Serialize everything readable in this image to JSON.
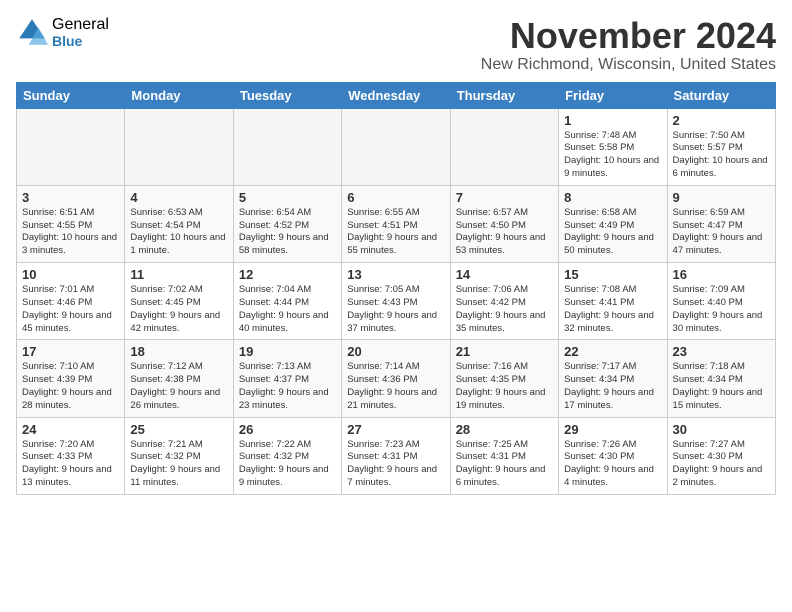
{
  "logo": {
    "general": "General",
    "blue": "Blue"
  },
  "title": "November 2024",
  "location": "New Richmond, Wisconsin, United States",
  "days_of_week": [
    "Sunday",
    "Monday",
    "Tuesday",
    "Wednesday",
    "Thursday",
    "Friday",
    "Saturday"
  ],
  "weeks": [
    [
      {
        "day": "",
        "info": ""
      },
      {
        "day": "",
        "info": ""
      },
      {
        "day": "",
        "info": ""
      },
      {
        "day": "",
        "info": ""
      },
      {
        "day": "",
        "info": ""
      },
      {
        "day": "1",
        "info": "Sunrise: 7:48 AM\nSunset: 5:58 PM\nDaylight: 10 hours and 9 minutes."
      },
      {
        "day": "2",
        "info": "Sunrise: 7:50 AM\nSunset: 5:57 PM\nDaylight: 10 hours and 6 minutes."
      }
    ],
    [
      {
        "day": "3",
        "info": "Sunrise: 6:51 AM\nSunset: 4:55 PM\nDaylight: 10 hours and 3 minutes."
      },
      {
        "day": "4",
        "info": "Sunrise: 6:53 AM\nSunset: 4:54 PM\nDaylight: 10 hours and 1 minute."
      },
      {
        "day": "5",
        "info": "Sunrise: 6:54 AM\nSunset: 4:52 PM\nDaylight: 9 hours and 58 minutes."
      },
      {
        "day": "6",
        "info": "Sunrise: 6:55 AM\nSunset: 4:51 PM\nDaylight: 9 hours and 55 minutes."
      },
      {
        "day": "7",
        "info": "Sunrise: 6:57 AM\nSunset: 4:50 PM\nDaylight: 9 hours and 53 minutes."
      },
      {
        "day": "8",
        "info": "Sunrise: 6:58 AM\nSunset: 4:49 PM\nDaylight: 9 hours and 50 minutes."
      },
      {
        "day": "9",
        "info": "Sunrise: 6:59 AM\nSunset: 4:47 PM\nDaylight: 9 hours and 47 minutes."
      }
    ],
    [
      {
        "day": "10",
        "info": "Sunrise: 7:01 AM\nSunset: 4:46 PM\nDaylight: 9 hours and 45 minutes."
      },
      {
        "day": "11",
        "info": "Sunrise: 7:02 AM\nSunset: 4:45 PM\nDaylight: 9 hours and 42 minutes."
      },
      {
        "day": "12",
        "info": "Sunrise: 7:04 AM\nSunset: 4:44 PM\nDaylight: 9 hours and 40 minutes."
      },
      {
        "day": "13",
        "info": "Sunrise: 7:05 AM\nSunset: 4:43 PM\nDaylight: 9 hours and 37 minutes."
      },
      {
        "day": "14",
        "info": "Sunrise: 7:06 AM\nSunset: 4:42 PM\nDaylight: 9 hours and 35 minutes."
      },
      {
        "day": "15",
        "info": "Sunrise: 7:08 AM\nSunset: 4:41 PM\nDaylight: 9 hours and 32 minutes."
      },
      {
        "day": "16",
        "info": "Sunrise: 7:09 AM\nSunset: 4:40 PM\nDaylight: 9 hours and 30 minutes."
      }
    ],
    [
      {
        "day": "17",
        "info": "Sunrise: 7:10 AM\nSunset: 4:39 PM\nDaylight: 9 hours and 28 minutes."
      },
      {
        "day": "18",
        "info": "Sunrise: 7:12 AM\nSunset: 4:38 PM\nDaylight: 9 hours and 26 minutes."
      },
      {
        "day": "19",
        "info": "Sunrise: 7:13 AM\nSunset: 4:37 PM\nDaylight: 9 hours and 23 minutes."
      },
      {
        "day": "20",
        "info": "Sunrise: 7:14 AM\nSunset: 4:36 PM\nDaylight: 9 hours and 21 minutes."
      },
      {
        "day": "21",
        "info": "Sunrise: 7:16 AM\nSunset: 4:35 PM\nDaylight: 9 hours and 19 minutes."
      },
      {
        "day": "22",
        "info": "Sunrise: 7:17 AM\nSunset: 4:34 PM\nDaylight: 9 hours and 17 minutes."
      },
      {
        "day": "23",
        "info": "Sunrise: 7:18 AM\nSunset: 4:34 PM\nDaylight: 9 hours and 15 minutes."
      }
    ],
    [
      {
        "day": "24",
        "info": "Sunrise: 7:20 AM\nSunset: 4:33 PM\nDaylight: 9 hours and 13 minutes."
      },
      {
        "day": "25",
        "info": "Sunrise: 7:21 AM\nSunset: 4:32 PM\nDaylight: 9 hours and 11 minutes."
      },
      {
        "day": "26",
        "info": "Sunrise: 7:22 AM\nSunset: 4:32 PM\nDaylight: 9 hours and 9 minutes."
      },
      {
        "day": "27",
        "info": "Sunrise: 7:23 AM\nSunset: 4:31 PM\nDaylight: 9 hours and 7 minutes."
      },
      {
        "day": "28",
        "info": "Sunrise: 7:25 AM\nSunset: 4:31 PM\nDaylight: 9 hours and 6 minutes."
      },
      {
        "day": "29",
        "info": "Sunrise: 7:26 AM\nSunset: 4:30 PM\nDaylight: 9 hours and 4 minutes."
      },
      {
        "day": "30",
        "info": "Sunrise: 7:27 AM\nSunset: 4:30 PM\nDaylight: 9 hours and 2 minutes."
      }
    ]
  ]
}
